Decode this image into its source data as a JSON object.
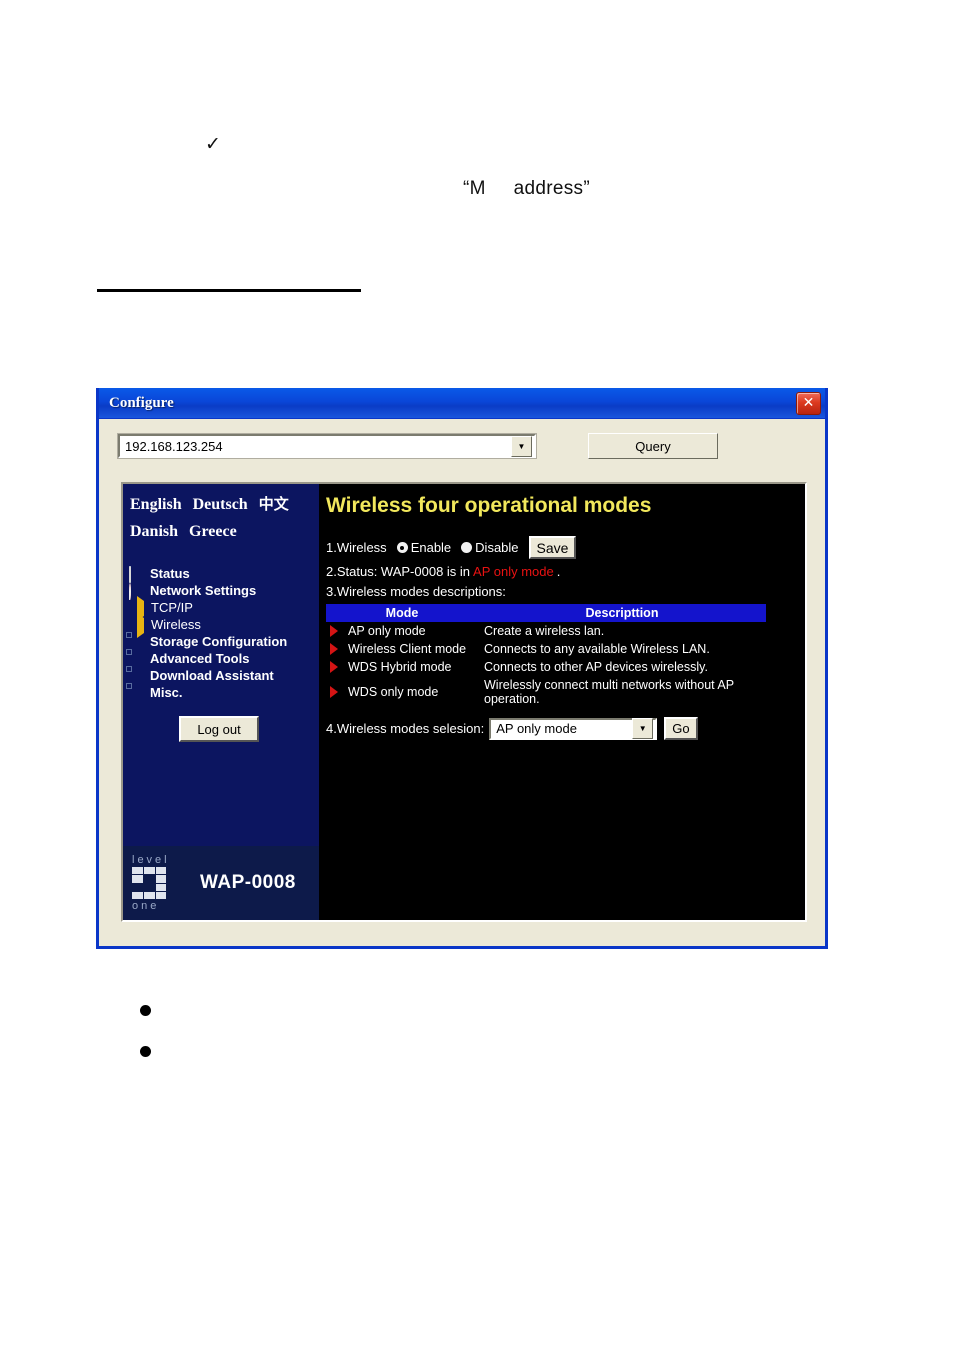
{
  "document": {
    "check_mark": "✓",
    "quoted_text": "“M     address”"
  },
  "window": {
    "title": "Configure",
    "close_label": "✕"
  },
  "toolbar": {
    "address_value": "192.168.123.254",
    "combo_arrow": "▼",
    "query_label": "Query"
  },
  "sidebar": {
    "languages_row1": [
      {
        "label": "English"
      },
      {
        "label": "Deutsch"
      },
      {
        "label": "中文"
      }
    ],
    "languages_row2": [
      {
        "label": "Danish"
      },
      {
        "label": "Greece"
      }
    ],
    "nav": [
      {
        "label": "Status",
        "icon": "monitor-icon",
        "type": "top"
      },
      {
        "label": "Network Settings",
        "icon": "shield-icon",
        "type": "top"
      },
      {
        "label": "TCP/IP",
        "icon": "arrow-icon",
        "type": "sub"
      },
      {
        "label": "Wireless",
        "icon": "arrow-icon",
        "type": "sub"
      },
      {
        "label": "Storage Configuration",
        "icon": "gear-icon",
        "type": "top"
      },
      {
        "label": "Advanced Tools",
        "icon": "gear-icon",
        "type": "top"
      },
      {
        "label": "Download Assistant",
        "icon": "gear-icon",
        "type": "top"
      },
      {
        "label": "Misc.",
        "icon": "gear-icon",
        "type": "top"
      }
    ],
    "logout_label": "Log out",
    "brand": {
      "word_top": "level",
      "word_bottom": "one",
      "model": "WAP-0008"
    }
  },
  "content": {
    "title": "Wireless four operational modes",
    "wireless_row": {
      "label": "1.Wireless",
      "enable_label": "Enable",
      "disable_label": "Disable",
      "selected": "Enable",
      "save_label": "Save"
    },
    "status_row": {
      "prefix": "2.Status: WAP-0008 is in",
      "mode": "AP only mode",
      "suffix": "."
    },
    "descriptions_label": "3.Wireless modes descriptions:",
    "table": {
      "headers": [
        "Mode",
        "Descripttion"
      ],
      "rows": [
        {
          "mode": "AP only mode",
          "desc": "Create a wireless lan."
        },
        {
          "mode": "Wireless Client mode",
          "desc": "Connects to any available Wireless LAN."
        },
        {
          "mode": "WDS Hybrid mode",
          "desc": "Connects to other AP devices wirelessly."
        },
        {
          "mode": "WDS only mode",
          "desc": "Wirelessly connect multi networks without AP operation."
        }
      ]
    },
    "selection_row": {
      "label": "4.Wireless modes selesion:",
      "selected": "AP only mode",
      "arrow": "▼",
      "go_label": "Go"
    }
  },
  "colors": {
    "title_yellow": "#f2e85c",
    "status_red": "#e81212",
    "table_header_blue": "#1414cc",
    "sidebar_navy": "#0c1560",
    "window_border": "#0a36c8"
  }
}
